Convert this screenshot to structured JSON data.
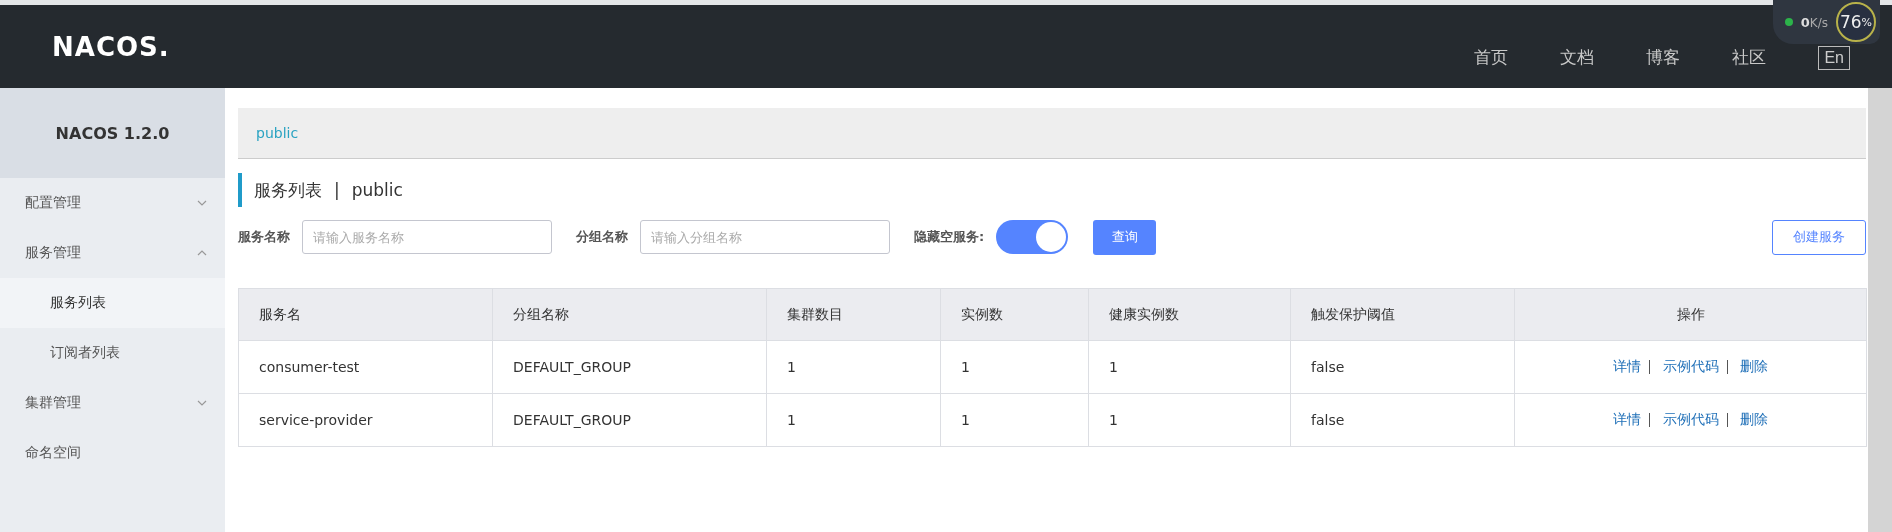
{
  "header": {
    "logo": "NACOS.",
    "nav": [
      {
        "label": "首页"
      },
      {
        "label": "文档"
      },
      {
        "label": "博客"
      },
      {
        "label": "社区"
      }
    ],
    "language_button": "En"
  },
  "network_widget": {
    "speed": "0",
    "speed_unit": "K/s",
    "gauge_value": "76",
    "gauge_unit": "%"
  },
  "sidebar": {
    "title": "NACOS 1.2.0",
    "items": [
      {
        "label": "配置管理",
        "expanded": false,
        "selected": false
      },
      {
        "label": "服务管理",
        "expanded": true,
        "selected": false,
        "children": [
          {
            "label": "服务列表",
            "selected": true
          },
          {
            "label": "订阅者列表",
            "selected": false
          }
        ]
      },
      {
        "label": "集群管理",
        "expanded": false,
        "selected": false
      },
      {
        "label": "命名空间",
        "selected": false
      }
    ]
  },
  "breadcrumb": "public",
  "page_title": {
    "title": "服务列表",
    "separator": "|",
    "namespace": "public"
  },
  "filters": {
    "service_name": {
      "label": "服务名称",
      "placeholder": "请输入服务名称"
    },
    "group_name": {
      "label": "分组名称",
      "placeholder": "请输入分组名称"
    },
    "hide_empty": {
      "label": "隐藏空服务:",
      "on": true
    },
    "query_button": "查询",
    "create_button": "创建服务"
  },
  "table": {
    "columns": [
      "服务名",
      "分组名称",
      "集群数目",
      "实例数",
      "健康实例数",
      "触发保护阈值",
      "操作"
    ],
    "rows": [
      {
        "cells": [
          "consumer-test",
          "DEFAULT_GROUP",
          "1",
          "1",
          "1",
          "false"
        ],
        "actions": [
          "详情",
          "示例代码",
          "删除"
        ]
      },
      {
        "cells": [
          "service-provider",
          "DEFAULT_GROUP",
          "1",
          "1",
          "1",
          "false"
        ],
        "actions": [
          "详情",
          "示例代码",
          "删除"
        ]
      }
    ]
  }
}
